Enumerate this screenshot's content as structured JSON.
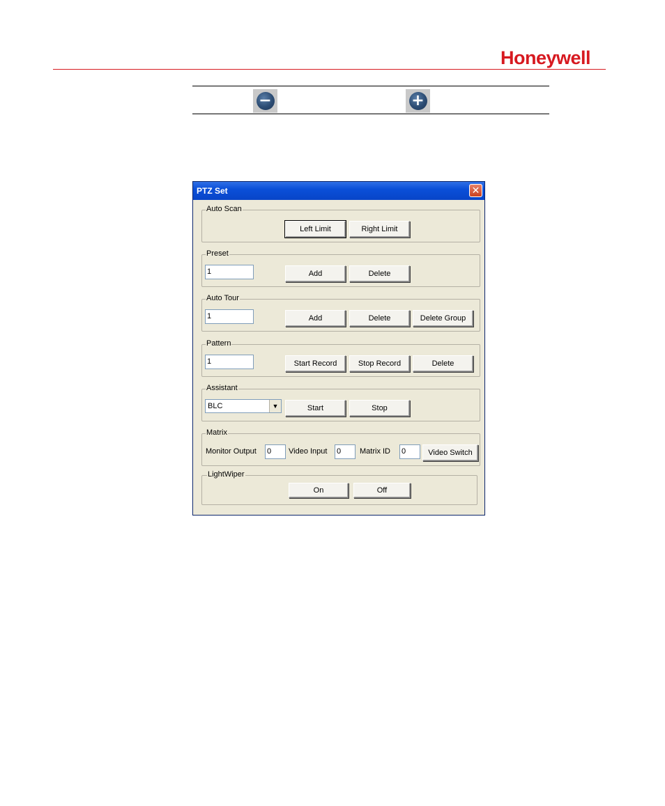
{
  "logo": {
    "text": "Honeywell"
  },
  "icons": {
    "minus": "−",
    "plus": "+"
  },
  "dialog": {
    "title": "PTZ Set",
    "close": "✕",
    "auto_scan": {
      "legend": "Auto Scan",
      "left_limit": "Left Limit",
      "right_limit": "Right Limit"
    },
    "preset": {
      "legend": "Preset",
      "value": "1",
      "add": "Add",
      "delete": "Delete"
    },
    "auto_tour": {
      "legend": "Auto Tour",
      "value": "1",
      "add": "Add",
      "delete": "Delete",
      "delete_group": "Delete Group"
    },
    "pattern": {
      "legend": "Pattern",
      "value": "1",
      "start_record": "Start Record",
      "stop_record": "Stop Record",
      "delete": "Delete"
    },
    "assistant": {
      "legend": "Assistant",
      "selected": "BLC",
      "start": "Start",
      "stop": "Stop"
    },
    "matrix": {
      "legend": "Matrix",
      "monitor_output_label": "Monitor Output",
      "monitor_output_value": "0",
      "video_input_label": "Video Input",
      "video_input_value": "0",
      "matrix_id_label": "Matrix ID",
      "matrix_id_value": "0",
      "video_switch": "Video Switch"
    },
    "light_wiper": {
      "legend": "LightWiper",
      "on": "On",
      "off": "Off"
    }
  }
}
